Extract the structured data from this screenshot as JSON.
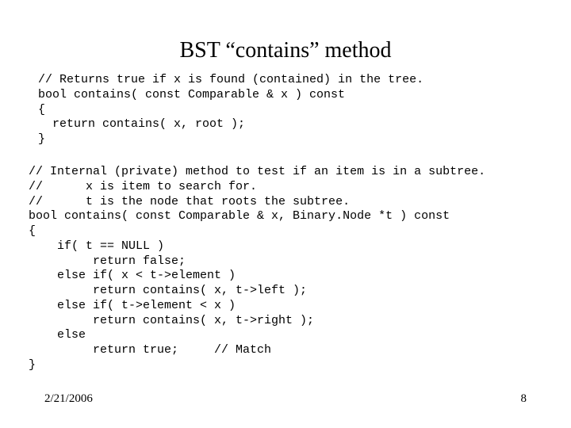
{
  "title": "BST “contains” method",
  "code1": "// Returns true if x is found (contained) in the tree.\nbool contains( const Comparable & x ) const\n{\n  return contains( x, root );\n}",
  "code2": "// Internal (private) method to test if an item is in a subtree.\n//      x is item to search for.\n//      t is the node that roots the subtree.\nbool contains( const Comparable & x, Binary.Node *t ) const\n{\n    if( t == NULL )\n         return false;\n    else if( x < t->element )\n         return contains( x, t->left );\n    else if( t->element < x )\n         return contains( x, t->right );\n    else\n         return true;     // Match\n}",
  "footer": {
    "date": "2/21/2006",
    "page": "8"
  }
}
